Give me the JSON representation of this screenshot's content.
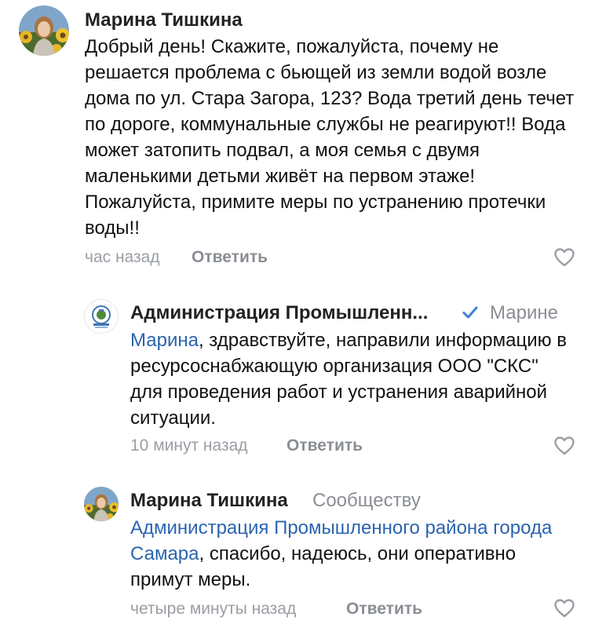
{
  "comments": [
    {
      "author": "Марина Тишкина",
      "text": "Добрый день! Скажите, пожалуйста, почему не решается проблема с бьющей из земли водой возле дома по ул. Стара Загора, 123? Вода третий день течет по дороге, коммунальные службы не реагируют!! Вода может затопить подвал, а моя семья с двумя маленькими детьми живёт на первом этаже!Пожалуйста, примите меры по устранению протечки воды!!",
      "time": "час назад",
      "reply_label": "Ответить"
    },
    {
      "author": "Администрация Промышленн...",
      "verified": true,
      "to": "Марине",
      "mention": "Марина",
      "text": ", здравствуйте, направили информацию в ресурсоснабжающую организация ООО \"СКС\" для проведения работ и устранения аварийной ситуации.",
      "time": "10 минут назад",
      "reply_label": "Ответить"
    },
    {
      "author": "Марина Тишкина",
      "to": "Сообществу",
      "mention": "Администрация Промышленного района города Самара",
      "text": ", спасибо, надеюсь, они оперативно примут меры.",
      "time": "четыре минуты назад",
      "reply_label": "Ответить"
    }
  ],
  "colors": {
    "mention": "#2a64b0",
    "meta": "#9a9ea4",
    "reply": "#8a8e94",
    "text": "#111111"
  },
  "icons": [
    "user-avatar",
    "community-logo-avatar",
    "verified-check-icon",
    "heart-icon"
  ]
}
